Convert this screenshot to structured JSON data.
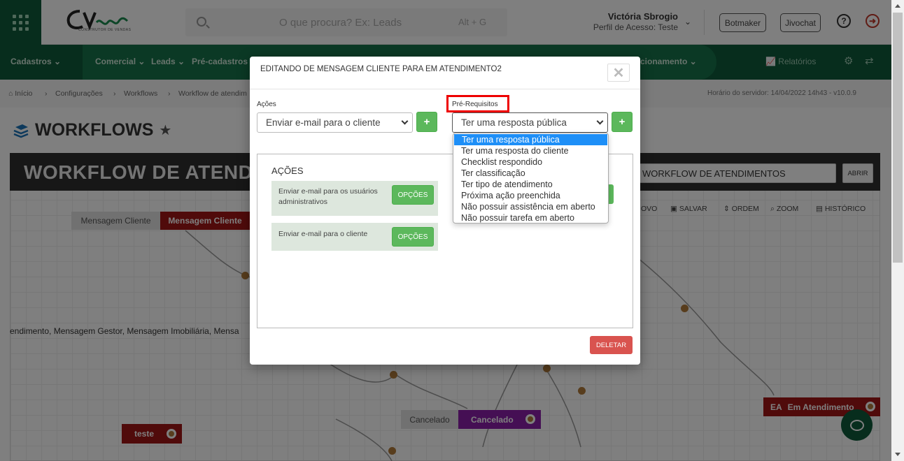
{
  "topbar": {
    "logo_text": "CV",
    "logo_sub": "CONSTRUTOR DE VENDAS",
    "search_placeholder": "O que procura? Ex: Leads",
    "search_shortcut": "Alt + G",
    "user_name": "Victória Sbrogio",
    "user_profile": "Perfil de Acesso: Teste",
    "botmaker_label": "Botmaker",
    "jivochat_label": "Jivochat",
    "help_icon_glyph": "?",
    "logout_icon_glyph": "➜"
  },
  "nav": {
    "cadastros": "Cadastros",
    "comercial": "Comercial",
    "leads": "Leads",
    "pre_cadastros": "Pré-cadastros",
    "relacionamento_tail": "cionamento",
    "relatorios": "Relatórios"
  },
  "breadcrumb": {
    "home": "Início",
    "configuracoes": "Configurações",
    "workflows": "Workflows",
    "current": "Workflow de atendim",
    "server_time": "Horário do servidor: 14/04/2022 14h43 - v10.0.9"
  },
  "page": {
    "title": "WORKFLOWS",
    "workflow_header": "WORKFLOW DE ATEND",
    "workflow_select": "WORKFLOW DE ATENDIMENTOS",
    "abrir_label": "ABRIR",
    "toolbar": {
      "novo": "OVO",
      "salvar": "SALVAR",
      "ordem": "ORDEM",
      "zoom": "ZOOM",
      "historico": "HISTÓRICO"
    }
  },
  "diagram": {
    "node_mensagem_cliente_gray": "Mensagem Cliente",
    "node_mensagem_cliente_red": "Mensagem Cliente",
    "long_label": "endimento, Mensagem Gestor, Mensagem Imobiliária, Mensa",
    "node_cancelado_gray": "Cancelado",
    "node_cancelado_purple": "Cancelado",
    "node_teste": "teste",
    "node_ea_code": "EA",
    "node_ea_label": "Em Atendimento"
  },
  "modal": {
    "title": "EDITANDO DE MENSAGEM CLIENTE PARA EM ATENDIMENTO2",
    "close_glyph": "✕",
    "acoes_label": "Ações",
    "acoes_selected": "Enviar e-mail para o cliente",
    "prereq_label": "Pré-Requisitos",
    "prereq_selected": "Ter uma resposta pública",
    "add_glyph": "+",
    "actions_heading": "AÇÕES",
    "action_cards": [
      {
        "text": "Enviar e-mail para os usuários administrativos",
        "button": "OPÇÕES"
      },
      {
        "text": "Enviar e-mail para o cliente",
        "button": "OPÇÕES"
      }
    ],
    "delete_label": "DELETAR"
  },
  "prereq_options": [
    "Ter uma resposta pública",
    "Ter uma resposta do cliente",
    "Checklist respondido",
    "Ter classificação",
    "Ter tipo de atendimento",
    "Próxima ação preenchida",
    "Não possuir assistência em aberto",
    "Não possuir tarefa em aberto"
  ],
  "colors": {
    "brand_dark_green": "#0f5a3a",
    "nav_green": "#17734a",
    "success_green": "#5cb85c",
    "danger_red": "#d9534f",
    "node_red": "#a11616",
    "node_purple": "#8b1fa8",
    "selection_blue": "#1e8ff7"
  }
}
